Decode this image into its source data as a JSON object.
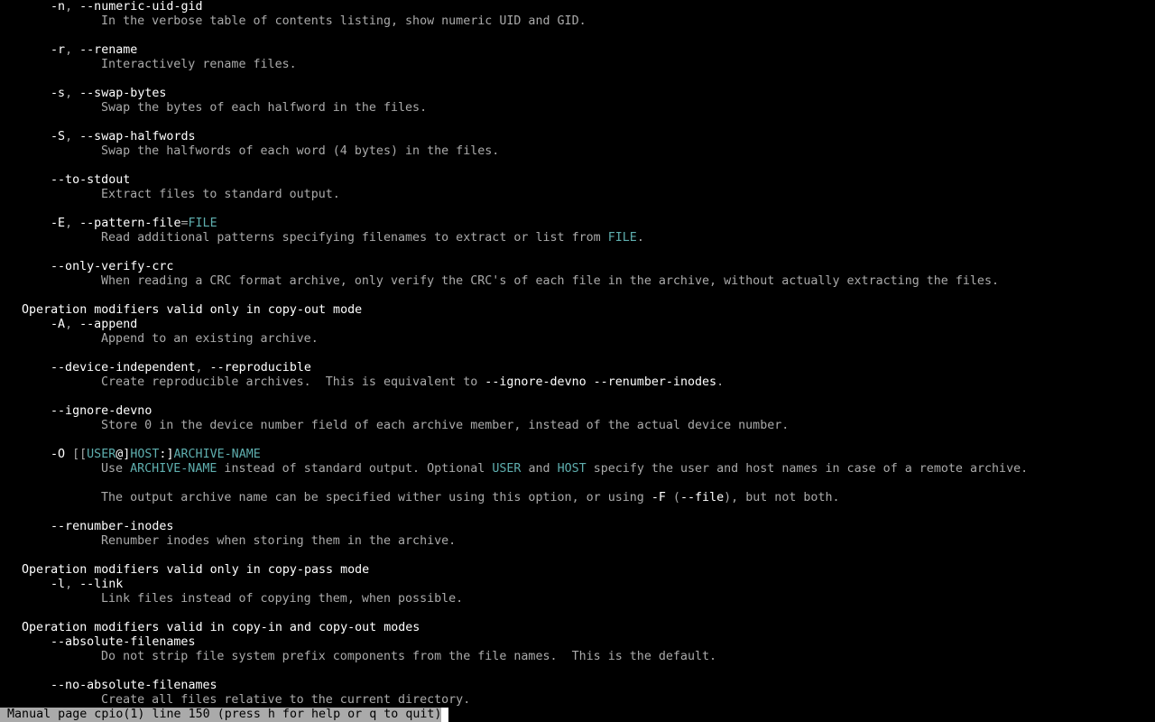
{
  "terminal": {
    "colors": {
      "background": "#000000",
      "text": "#aaaaaa",
      "bold": "#ffffff",
      "underline": "#5fafaf",
      "status_bg": "#aaaaaa",
      "status_fg": "#000000"
    },
    "lines": [
      {
        "indent": 7,
        "segments": [
          {
            "t": "-n",
            "s": "b"
          },
          {
            "t": ", ",
            "s": "n"
          },
          {
            "t": "--numeric-uid-gid",
            "s": "b"
          }
        ]
      },
      {
        "indent": 14,
        "segments": [
          {
            "t": "In the verbose table of contents listing, show numeric UID and GID.",
            "s": "n"
          }
        ]
      },
      {
        "indent": 0,
        "segments": []
      },
      {
        "indent": 7,
        "segments": [
          {
            "t": "-r",
            "s": "b"
          },
          {
            "t": ", ",
            "s": "n"
          },
          {
            "t": "--rename",
            "s": "b"
          }
        ]
      },
      {
        "indent": 14,
        "segments": [
          {
            "t": "Interactively rename files.",
            "s": "n"
          }
        ]
      },
      {
        "indent": 0,
        "segments": []
      },
      {
        "indent": 7,
        "segments": [
          {
            "t": "-s",
            "s": "b"
          },
          {
            "t": ", ",
            "s": "n"
          },
          {
            "t": "--swap-bytes",
            "s": "b"
          }
        ]
      },
      {
        "indent": 14,
        "segments": [
          {
            "t": "Swap the bytes of each halfword in the files.",
            "s": "n"
          }
        ]
      },
      {
        "indent": 0,
        "segments": []
      },
      {
        "indent": 7,
        "segments": [
          {
            "t": "-S",
            "s": "b"
          },
          {
            "t": ", ",
            "s": "n"
          },
          {
            "t": "--swap-halfwords",
            "s": "b"
          }
        ]
      },
      {
        "indent": 14,
        "segments": [
          {
            "t": "Swap the halfwords of each word (4 bytes) in the files.",
            "s": "n"
          }
        ]
      },
      {
        "indent": 0,
        "segments": []
      },
      {
        "indent": 7,
        "segments": [
          {
            "t": "--to-stdout",
            "s": "b"
          }
        ]
      },
      {
        "indent": 14,
        "segments": [
          {
            "t": "Extract files to standard output.",
            "s": "n"
          }
        ]
      },
      {
        "indent": 0,
        "segments": []
      },
      {
        "indent": 7,
        "segments": [
          {
            "t": "-E",
            "s": "b"
          },
          {
            "t": ", ",
            "s": "n"
          },
          {
            "t": "--pattern-file",
            "s": "b"
          },
          {
            "t": "=",
            "s": "n"
          },
          {
            "t": "FILE",
            "s": "u"
          }
        ]
      },
      {
        "indent": 14,
        "segments": [
          {
            "t": "Read additional patterns specifying filenames to extract or list from ",
            "s": "n"
          },
          {
            "t": "FILE",
            "s": "u"
          },
          {
            "t": ".",
            "s": "n"
          }
        ]
      },
      {
        "indent": 0,
        "segments": []
      },
      {
        "indent": 7,
        "segments": [
          {
            "t": "--only-verify-crc",
            "s": "b"
          }
        ]
      },
      {
        "indent": 14,
        "segments": [
          {
            "t": "When reading a CRC format archive, only verify the CRC's of each file in the archive, without actually extracting the files.",
            "s": "n"
          }
        ]
      },
      {
        "indent": 0,
        "segments": []
      },
      {
        "indent": 3,
        "segments": [
          {
            "t": "Operation modifiers valid only in copy-out mode",
            "s": "b"
          }
        ]
      },
      {
        "indent": 7,
        "segments": [
          {
            "t": "-A",
            "s": "b"
          },
          {
            "t": ", ",
            "s": "n"
          },
          {
            "t": "--append",
            "s": "b"
          }
        ]
      },
      {
        "indent": 14,
        "segments": [
          {
            "t": "Append to an existing archive.",
            "s": "n"
          }
        ]
      },
      {
        "indent": 0,
        "segments": []
      },
      {
        "indent": 7,
        "segments": [
          {
            "t": "--device-independent",
            "s": "b"
          },
          {
            "t": ", ",
            "s": "n"
          },
          {
            "t": "--reproducible",
            "s": "b"
          }
        ]
      },
      {
        "indent": 14,
        "segments": [
          {
            "t": "Create reproducible archives.  This is equivalent to ",
            "s": "n"
          },
          {
            "t": "--ignore-devno --renumber-inodes",
            "s": "b"
          },
          {
            "t": ".",
            "s": "n"
          }
        ]
      },
      {
        "indent": 0,
        "segments": []
      },
      {
        "indent": 7,
        "segments": [
          {
            "t": "--ignore-devno",
            "s": "b"
          }
        ]
      },
      {
        "indent": 14,
        "segments": [
          {
            "t": "Store 0 in the device number field of each archive member, instead of the actual device number.",
            "s": "n"
          }
        ]
      },
      {
        "indent": 0,
        "segments": []
      },
      {
        "indent": 7,
        "segments": [
          {
            "t": "-O",
            "s": "b"
          },
          {
            "t": " [[",
            "s": "n"
          },
          {
            "t": "USER",
            "s": "u"
          },
          {
            "t": "@]",
            "s": "b"
          },
          {
            "t": "HOST",
            "s": "u"
          },
          {
            "t": ":]",
            "s": "b"
          },
          {
            "t": "ARCHIVE-NAME",
            "s": "u"
          }
        ]
      },
      {
        "indent": 14,
        "segments": [
          {
            "t": "Use ",
            "s": "n"
          },
          {
            "t": "ARCHIVE-NAME",
            "s": "u"
          },
          {
            "t": " instead of standard output. Optional ",
            "s": "n"
          },
          {
            "t": "USER",
            "s": "u"
          },
          {
            "t": " and ",
            "s": "n"
          },
          {
            "t": "HOST",
            "s": "u"
          },
          {
            "t": " specify the user and host names in case of a remote archive.",
            "s": "n"
          }
        ]
      },
      {
        "indent": 0,
        "segments": []
      },
      {
        "indent": 14,
        "segments": [
          {
            "t": "The output archive name can be specified wither using this option, or using ",
            "s": "n"
          },
          {
            "t": "-F",
            "s": "b"
          },
          {
            "t": " (",
            "s": "n"
          },
          {
            "t": "--file",
            "s": "b"
          },
          {
            "t": "), but not both.",
            "s": "n"
          }
        ]
      },
      {
        "indent": 0,
        "segments": []
      },
      {
        "indent": 7,
        "segments": [
          {
            "t": "--renumber-inodes",
            "s": "b"
          }
        ]
      },
      {
        "indent": 14,
        "segments": [
          {
            "t": "Renumber inodes when storing them in the archive.",
            "s": "n"
          }
        ]
      },
      {
        "indent": 0,
        "segments": []
      },
      {
        "indent": 3,
        "segments": [
          {
            "t": "Operation modifiers valid only in copy-pass mode",
            "s": "b"
          }
        ]
      },
      {
        "indent": 7,
        "segments": [
          {
            "t": "-l",
            "s": "b"
          },
          {
            "t": ", ",
            "s": "n"
          },
          {
            "t": "--link",
            "s": "b"
          }
        ]
      },
      {
        "indent": 14,
        "segments": [
          {
            "t": "Link files instead of copying them, when possible.",
            "s": "n"
          }
        ]
      },
      {
        "indent": 0,
        "segments": []
      },
      {
        "indent": 3,
        "segments": [
          {
            "t": "Operation modifiers valid in copy-in and copy-out modes",
            "s": "b"
          }
        ]
      },
      {
        "indent": 7,
        "segments": [
          {
            "t": "--absolute-filenames",
            "s": "b"
          }
        ]
      },
      {
        "indent": 14,
        "segments": [
          {
            "t": "Do not strip file system prefix components from the file names.  This is the default.",
            "s": "n"
          }
        ]
      },
      {
        "indent": 0,
        "segments": []
      },
      {
        "indent": 7,
        "segments": [
          {
            "t": "--no-absolute-filenames",
            "s": "b"
          }
        ]
      },
      {
        "indent": 14,
        "segments": [
          {
            "t": "Create all files relative to the current directory.",
            "s": "n"
          }
        ]
      }
    ],
    "status_line": "Manual page cpio(1) line 150 (press h for help or q to quit)"
  }
}
